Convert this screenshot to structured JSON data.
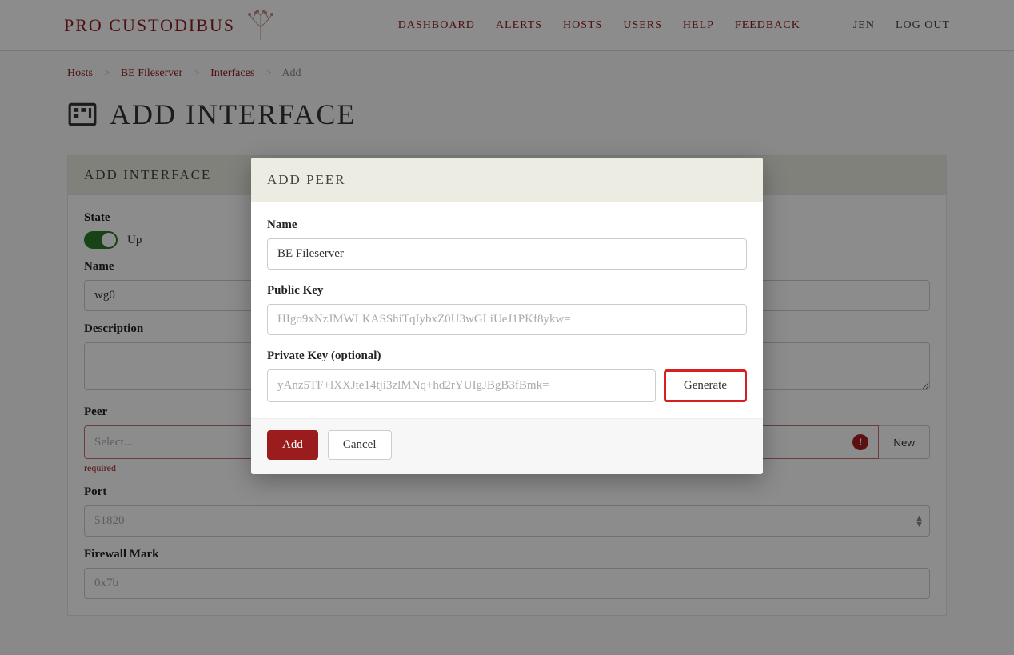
{
  "brand": "PRO CUSTODIBUS",
  "nav": {
    "dashboard": "DASHBOARD",
    "alerts": "ALERTS",
    "hosts": "HOSTS",
    "users": "USERS",
    "help": "HELP",
    "feedback": "FEEDBACK",
    "user": "JEN",
    "logout": "LOG OUT"
  },
  "breadcrumb": {
    "hosts": "Hosts",
    "host": "BE Fileserver",
    "interfaces": "Interfaces",
    "add": "Add"
  },
  "page": {
    "title": "ADD INTERFACE"
  },
  "form": {
    "card_title": "ADD INTERFACE",
    "state_label": "State",
    "state_value": "Up",
    "name_label": "Name",
    "name_value": "wg0",
    "description_label": "Description",
    "description_value": "",
    "peer_label": "Peer",
    "peer_placeholder": "Select...",
    "peer_new": "New",
    "required": "required",
    "port_label": "Port",
    "port_placeholder": "51820",
    "fwmark_label": "Firewall Mark",
    "fwmark_placeholder": "0x7b"
  },
  "modal": {
    "title": "ADD PEER",
    "name_label": "Name",
    "name_value": "BE Fileserver",
    "pubkey_label": "Public Key",
    "pubkey_placeholder": "HIgo9xNzJMWLKASShiTqIybxZ0U3wGLiUeJ1PKf8ykw=",
    "privkey_label": "Private Key (optional)",
    "privkey_placeholder": "yAnz5TF+lXXJte14tji3zlMNq+hd2rYUIgJBgB3fBmk=",
    "generate": "Generate",
    "add": "Add",
    "cancel": "Cancel"
  }
}
